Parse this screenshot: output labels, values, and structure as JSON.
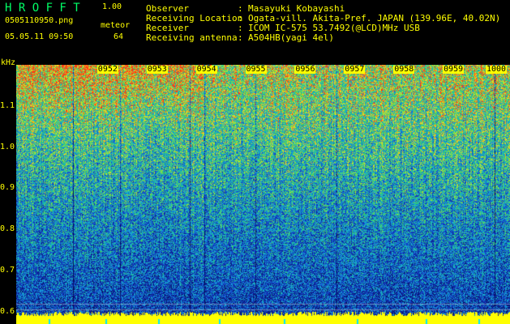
{
  "app": {
    "name": "H R O F F T",
    "version": "1.00"
  },
  "file": {
    "name": "0505110950.png",
    "datetime": "05.05.11 09:50"
  },
  "mode": {
    "label": "meteor",
    "count": "64"
  },
  "info": [
    {
      "key": "Observer",
      "sep": ":",
      "value": "Masayuki Kobayashi"
    },
    {
      "key": "Receiving Location",
      "sep": ":",
      "value": "Ogata-vill. Akita-Pref. JAPAN (139.96E, 40.02N)"
    },
    {
      "key": "Receiver",
      "sep": ":",
      "value": "ICOM IC-575 53.7492(@LCD)MHz USB"
    },
    {
      "key": "Receiving antenna",
      "sep": ":",
      "value": "A504HB(yagi 4el)"
    }
  ],
  "axis": {
    "unit": "kHz",
    "ylabels": [
      "1.1",
      "1.0",
      "0.9",
      "0.8",
      "0.7",
      "0.6"
    ],
    "yvalues": [
      1.1,
      1.0,
      0.9,
      0.8,
      0.7,
      0.6
    ],
    "ylim": [
      0.57,
      1.2
    ],
    "time_labels": [
      "0952",
      "0953",
      "0954",
      "0955",
      "0956",
      "0957",
      "0958",
      "0959",
      "1000"
    ],
    "time_minutes": [
      2,
      3,
      4,
      5,
      6,
      7,
      8,
      9,
      10
    ],
    "xlim": [
      0,
      10
    ]
  },
  "colors": {
    "background": "#000000",
    "title": "#00ff66",
    "text": "#ffff00",
    "spectrum_low": "#0a1a8c",
    "spectrum_high": "#ff3a1a",
    "baseline": "#ffff00"
  }
}
